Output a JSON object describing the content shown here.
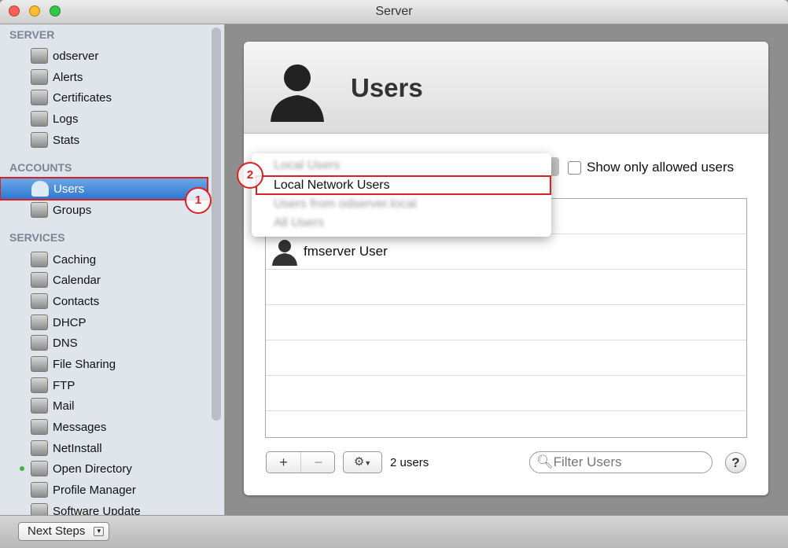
{
  "window": {
    "title": "Server"
  },
  "sidebar": {
    "sections": [
      {
        "label": "SERVER",
        "items": [
          {
            "label": "odserver",
            "icon": "computer-icon"
          },
          {
            "label": "Alerts",
            "icon": "megaphone-icon"
          },
          {
            "label": "Certificates",
            "icon": "certificate-icon"
          },
          {
            "label": "Logs",
            "icon": "document-icon"
          },
          {
            "label": "Stats",
            "icon": "bar-chart-icon"
          }
        ]
      },
      {
        "label": "ACCOUNTS",
        "items": [
          {
            "label": "Users",
            "icon": "user-icon",
            "selected": true
          },
          {
            "label": "Groups",
            "icon": "group-icon"
          }
        ]
      },
      {
        "label": "SERVICES",
        "items": [
          {
            "label": "Caching",
            "icon": "caching-icon"
          },
          {
            "label": "Calendar",
            "icon": "calendar-icon"
          },
          {
            "label": "Contacts",
            "icon": "contacts-icon"
          },
          {
            "label": "DHCP",
            "icon": "dhcp-icon"
          },
          {
            "label": "DNS",
            "icon": "dns-icon"
          },
          {
            "label": "File Sharing",
            "icon": "folder-icon"
          },
          {
            "label": "FTP",
            "icon": "ftp-icon"
          },
          {
            "label": "Mail",
            "icon": "mail-icon"
          },
          {
            "label": "Messages",
            "icon": "messages-icon"
          },
          {
            "label": "NetInstall",
            "icon": "netinstall-icon"
          },
          {
            "label": "Open Directory",
            "icon": "open-directory-icon",
            "status": "running"
          },
          {
            "label": "Profile Manager",
            "icon": "profile-manager-icon"
          },
          {
            "label": "Software Update",
            "icon": "software-update-icon"
          }
        ]
      }
    ]
  },
  "callouts": [
    "1",
    "2"
  ],
  "bottom": {
    "next_steps": "Next Steps"
  },
  "main": {
    "title": "Users",
    "show_only_allowed": "Show only allowed users",
    "dropdown": {
      "selected": "Local Users",
      "options": [
        "Local Network Users",
        "Users from odserver.local",
        "All Users"
      ],
      "highlighted": "Local Network Users"
    },
    "users": [
      "fmserver User"
    ],
    "add": "+",
    "remove": "−",
    "count": "2 users",
    "filter_placeholder": "Filter Users",
    "help": "?"
  },
  "colors": {
    "accent": "#3a82d8",
    "callout": "#e02020",
    "status": "#3fb43f"
  }
}
